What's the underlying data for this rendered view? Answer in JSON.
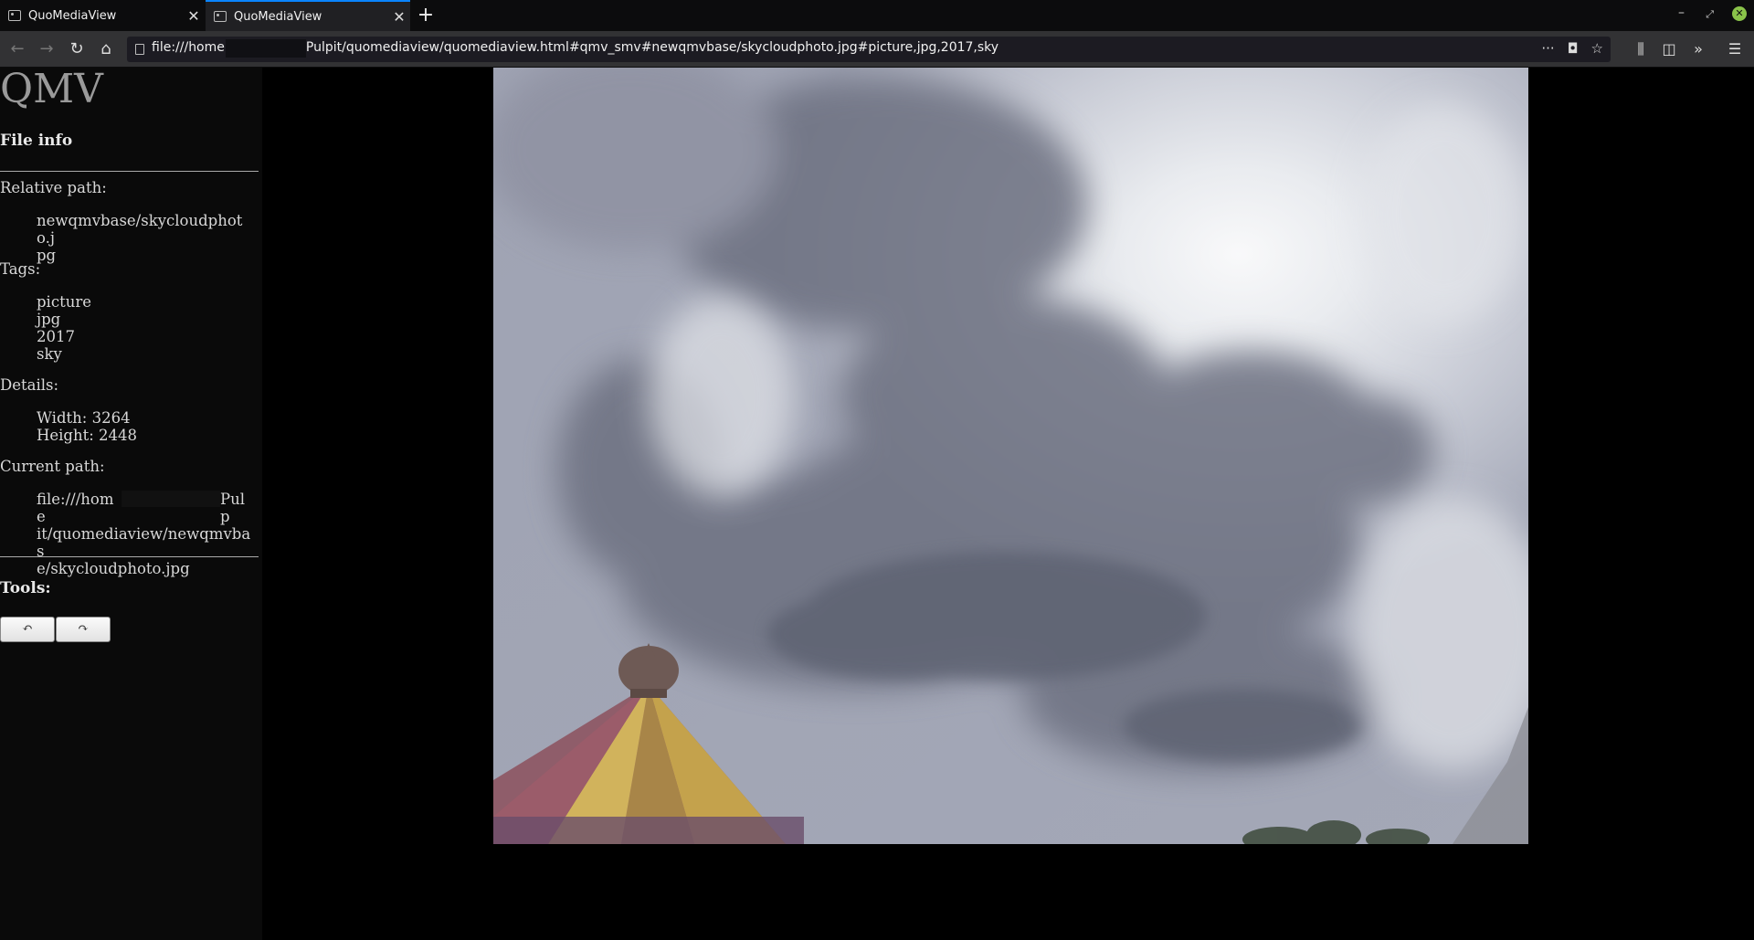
{
  "browser": {
    "tabs": [
      {
        "title": "QuoMediaView",
        "active": false
      },
      {
        "title": "QuoMediaView",
        "active": true
      }
    ],
    "url": {
      "prefix": "file:///home",
      "suffix": "Pulpit/quomediaview/quomediaview.html#qmv_smv#newqmvbase/skycloudphoto.jpg#picture,jpg,2017,sky"
    },
    "url_tools": "···",
    "accent": "#0a84ff"
  },
  "sidebar": {
    "logo": "QMV",
    "file_info_heading": "File info",
    "relative_path_label": "Relative path:",
    "relative_path_lines": [
      "newqmvbase/skycloudphoto.j",
      "pg"
    ],
    "tags_label": "Tags:",
    "tags": [
      "picture",
      "jpg",
      "2017",
      "sky"
    ],
    "details_label": "Details:",
    "width_text": "Width: 3264",
    "height_text": "Height: 2448",
    "current_path_label": "Current path:",
    "current_path_start": "file:///home",
    "current_path_end": "Pulp",
    "current_path_lines": [
      "it/quomediaview/newqmvbas",
      "e/skycloudphoto.jpg"
    ],
    "tools_heading": "Tools:",
    "rotate_left_label": "↶",
    "rotate_right_label": "↷"
  }
}
